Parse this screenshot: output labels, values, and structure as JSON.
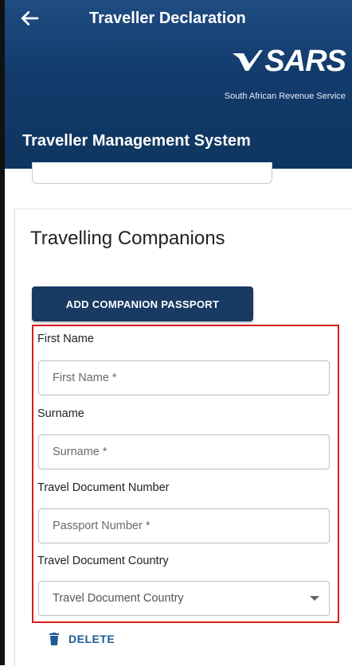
{
  "header": {
    "title": "Traveller Declaration",
    "logo_text": "SARS",
    "logo_subtitle": "South African Revenue Service",
    "system_title": "Traveller Management System",
    "colors": {
      "background": "#123b6c",
      "text": "#ffffff"
    }
  },
  "section": {
    "title": "Travelling Companions",
    "add_button_label": "ADD COMPANION PASSPORT"
  },
  "form": {
    "first_name": {
      "label": "First Name",
      "placeholder": "First Name *",
      "value": ""
    },
    "surname": {
      "label": "Surname",
      "placeholder": "Surname *",
      "value": ""
    },
    "document_number": {
      "label": "Travel Document Number",
      "placeholder": "Passport Number *",
      "value": ""
    },
    "document_country": {
      "label": "Travel Document Country",
      "selected": "Travel Document Country"
    },
    "delete_label": "DELETE"
  },
  "icons": {
    "back": "arrow-left-icon",
    "logo": "sars-logo-icon",
    "dropdown": "chevron-down-icon",
    "delete": "trash-icon"
  },
  "colors": {
    "primary_button": "#183a63",
    "highlight_border": "#d81b1b",
    "delete_text": "#1f5a96"
  }
}
